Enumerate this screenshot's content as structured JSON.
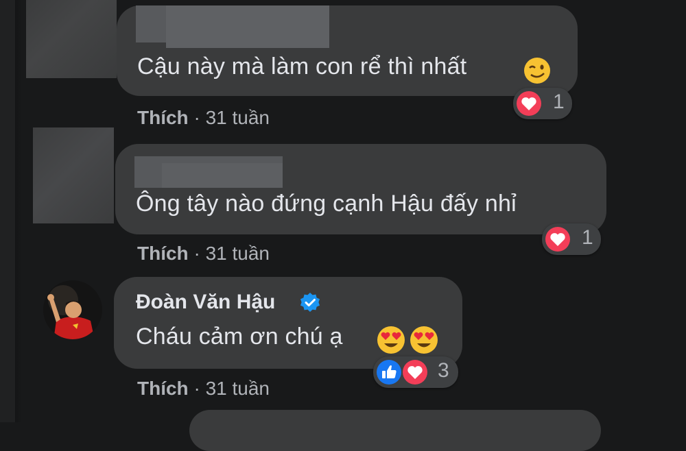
{
  "comments": [
    {
      "text": "Cậu này mà làm con rể thì nhất",
      "emoji_icons": [
        "wink-emoji"
      ],
      "actions": {
        "like_label": "Thích",
        "separator": " · ",
        "time": "31 tuần"
      },
      "reactions": {
        "icons": [
          "love-icon"
        ],
        "count": "1"
      }
    },
    {
      "text": "Ông tây nào đứng cạnh Hậu đấy nhỉ",
      "emoji_icons": [],
      "actions": {
        "like_label": "Thích",
        "separator": " · ",
        "time": "31 tuần"
      },
      "reactions": {
        "icons": [
          "love-icon"
        ],
        "count": "1"
      }
    },
    {
      "author": "Đoàn Văn Hậu",
      "verified": true,
      "text": "Cháu cảm ơn chú ạ",
      "emoji_icons": [
        "heart-eyes-emoji",
        "heart-eyes-emoji"
      ],
      "actions": {
        "like_label": "Thích",
        "separator": " · ",
        "time": "31 tuần"
      },
      "reactions": {
        "icons": [
          "like-icon",
          "love-icon"
        ],
        "count": "3"
      }
    }
  ],
  "colors": {
    "background": "#18191a",
    "bubble": "#3a3b3c",
    "text": "#e4e6eb",
    "secondary_text": "#b0b3b8",
    "love_red": "#f33e58",
    "like_blue": "#1877f2",
    "verified_blue": "#1b95f2"
  }
}
